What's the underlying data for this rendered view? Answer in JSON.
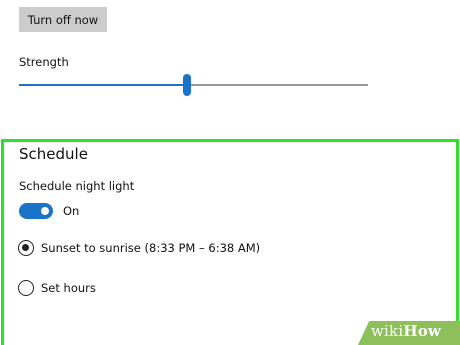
{
  "night_light": {
    "turn_off_button": "Turn off now",
    "strength_label": "Strength",
    "strength_value_percent": 48
  },
  "schedule": {
    "title": "Schedule",
    "toggle_label": "Schedule night light",
    "toggle_state": "On",
    "toggle_on": true,
    "options": [
      {
        "label": "Sunset to sunrise (8:33 PM – 6:38 AM)",
        "selected": true
      },
      {
        "label": "Set hours",
        "selected": false
      }
    ]
  },
  "watermark": {
    "wiki": "wiki",
    "how": "How"
  },
  "colors": {
    "accent": "#1a73c8",
    "highlight": "#2ee026",
    "watermark_bg": "#8dbf5a"
  }
}
